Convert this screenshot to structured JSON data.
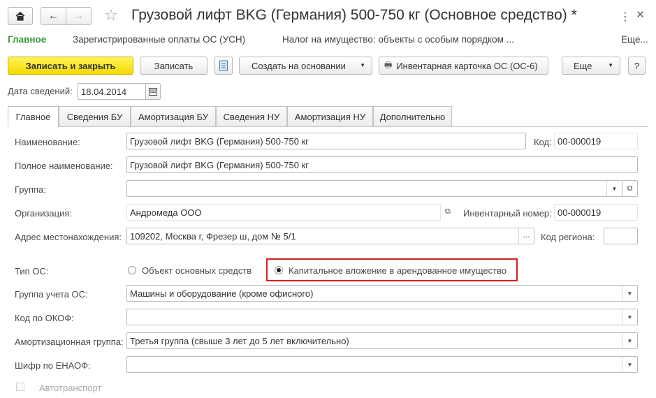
{
  "window": {
    "title": "Грузовой лифт BKG (Германия) 500-750 кг (Основное средство) *"
  },
  "nav_links": {
    "main": "Главное",
    "registered_payments": "Зарегистрированные оплаты ОС (УСН)",
    "property_tax": "Налог на имущество: объекты с особым порядком ...",
    "more": "Еще..."
  },
  "toolbar": {
    "save_close": "Записать и закрыть",
    "save": "Записать",
    "create_based": "Создать на основании",
    "inventory_card": "Инвентарная карточка ОС (ОС-6)",
    "more": "Еще",
    "help": "?"
  },
  "info_date": {
    "label": "Дата сведений:",
    "value": "18.04.2014"
  },
  "tabs": [
    {
      "label": "Главное"
    },
    {
      "label": "Сведения БУ"
    },
    {
      "label": "Амортизация БУ"
    },
    {
      "label": "Сведения НУ"
    },
    {
      "label": "Амортизация НУ"
    },
    {
      "label": "Дополнительно"
    }
  ],
  "form": {
    "name": {
      "label": "Наименование:",
      "value": "Грузовой лифт BKG (Германия) 500-750 кг"
    },
    "code": {
      "label": "Код:",
      "value": "00-000019"
    },
    "full_name": {
      "label": "Полное наименование:",
      "value": "Грузовой лифт BKG (Германия) 500-750 кг"
    },
    "group": {
      "label": "Группа:",
      "value": ""
    },
    "organization": {
      "label": "Организация:",
      "value": "Андромеда ООО"
    },
    "inventory_number": {
      "label": "Инвентарный номер:",
      "value": "00-000019"
    },
    "address": {
      "label": "Адрес местонахождения:",
      "value": "109202, Москва г, Фрезер ш, дом № 5/1"
    },
    "region_code": {
      "label": "Код региона:",
      "value": ""
    },
    "os_type": {
      "label": "Тип ОС:",
      "option1": "Объект основных средств",
      "option2": "Капитальное вложение в арендованное имущество",
      "selected": 2,
      "highlight_color": "#d42020"
    },
    "accounting_group": {
      "label": "Группа учета ОС:",
      "value": "Машины и оборудование (кроме офисного)"
    },
    "okof": {
      "label": "Код по ОКОФ:",
      "value": ""
    },
    "depreciation_group": {
      "label": "Амортизационная группа:",
      "value": "Третья группа (свыше 3 лет до 5 лет включительно)"
    },
    "enaof": {
      "label": "Шифр по ЕНАОФ:",
      "value": ""
    },
    "vehicle": {
      "label": "Автотранспорт",
      "checked": false
    }
  },
  "colors": {
    "primary_button": "#f5d900",
    "active_nav": "#3a9b3a"
  }
}
